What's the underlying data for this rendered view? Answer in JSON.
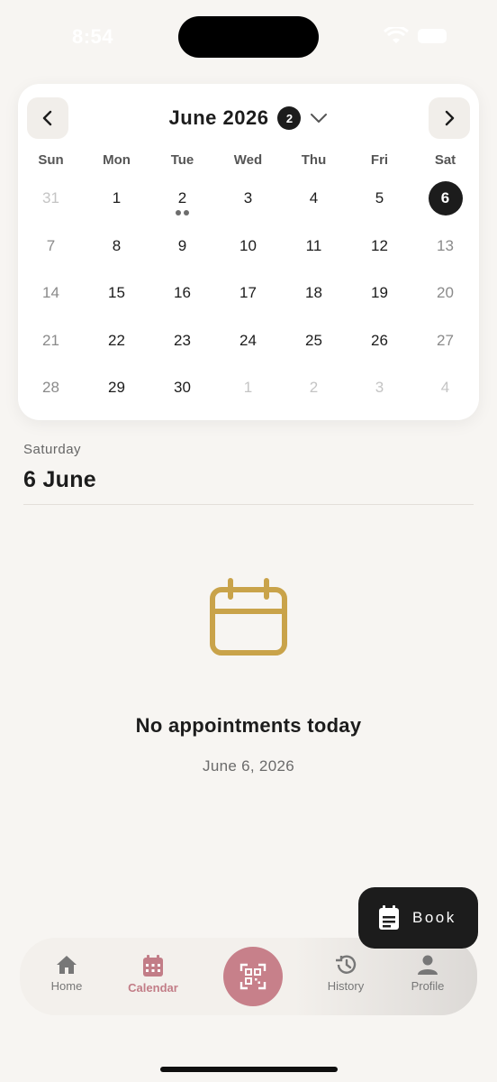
{
  "status_bar": {
    "time": "8:54"
  },
  "calendar": {
    "month_title": "June 2026",
    "badge_count": "2",
    "weekdays": [
      "Sun",
      "Mon",
      "Tue",
      "Wed",
      "Thu",
      "Fri",
      "Sat"
    ],
    "days": [
      {
        "d": "31",
        "muted": true
      },
      {
        "d": "1"
      },
      {
        "d": "2",
        "dots": 2
      },
      {
        "d": "3"
      },
      {
        "d": "4"
      },
      {
        "d": "5"
      },
      {
        "d": "6",
        "selected": true
      },
      {
        "d": "7",
        "weekend": true
      },
      {
        "d": "8"
      },
      {
        "d": "9"
      },
      {
        "d": "10"
      },
      {
        "d": "11"
      },
      {
        "d": "12"
      },
      {
        "d": "13",
        "weekend": true
      },
      {
        "d": "14",
        "weekend": true
      },
      {
        "d": "15"
      },
      {
        "d": "16"
      },
      {
        "d": "17"
      },
      {
        "d": "18"
      },
      {
        "d": "19"
      },
      {
        "d": "20",
        "weekend": true
      },
      {
        "d": "21",
        "weekend": true
      },
      {
        "d": "22"
      },
      {
        "d": "23"
      },
      {
        "d": "24"
      },
      {
        "d": "25"
      },
      {
        "d": "26"
      },
      {
        "d": "27",
        "weekend": true
      },
      {
        "d": "28",
        "weekend": true
      },
      {
        "d": "29"
      },
      {
        "d": "30"
      },
      {
        "d": "1",
        "muted": true
      },
      {
        "d": "2",
        "muted": true
      },
      {
        "d": "3",
        "muted": true
      },
      {
        "d": "4",
        "muted": true
      }
    ]
  },
  "selected_day": {
    "weekday": "Saturday",
    "date": "6 June"
  },
  "empty_state": {
    "icon": "calendar-icon",
    "title": "No appointments today",
    "date": "June 6, 2026"
  },
  "book_button": {
    "label": "Book",
    "icon": "booking-form-icon"
  },
  "bottom_nav": {
    "home": {
      "label": "Home",
      "icon": "home-icon"
    },
    "calendar": {
      "label": "Calendar",
      "icon": "calendar-icon"
    },
    "scan": {
      "icon": "qr-scan-icon"
    },
    "history": {
      "label": "History",
      "icon": "history-icon"
    },
    "profile": {
      "label": "Profile",
      "icon": "person-icon"
    }
  },
  "colors": {
    "background": "#f7f5f2",
    "accent": "#c7808a",
    "gold": "#c9a34a",
    "dark": "#1c1c1c"
  }
}
